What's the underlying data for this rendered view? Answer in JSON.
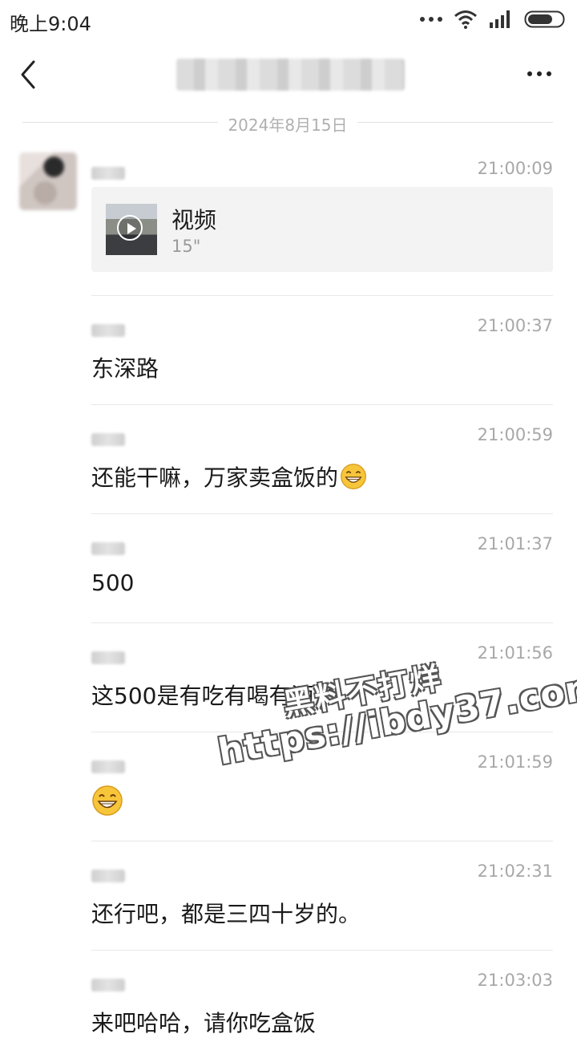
{
  "status_bar": {
    "time": "晚上9:04"
  },
  "nav": {
    "title": ""
  },
  "date_divider": "2024年8月15日",
  "messages": [
    {
      "time": "21:00:09",
      "type": "video",
      "video_label": "视频",
      "duration": "15\""
    },
    {
      "time": "21:00:37",
      "text": "东深路"
    },
    {
      "time": "21:00:59",
      "text": "还能干嘛，万家卖盒饭的",
      "emoji": "grinning-face-emoji"
    },
    {
      "time": "21:01:37",
      "text": "500"
    },
    {
      "time": "21:01:56",
      "text": "这500是有吃有喝有酒了"
    },
    {
      "time": "21:01:59",
      "emoji": "grinning-face-emoji"
    },
    {
      "time": "21:02:31",
      "text": "还行吧，都是三四十岁的。"
    },
    {
      "time": "21:03:03",
      "text": "来吧哈哈，请你吃盒饭"
    }
  ],
  "watermark": {
    "cn": "黑料不打烊",
    "url": "https://ibdy37.com"
  },
  "colors": {
    "timestamp": "#a8a8a8",
    "divider": "#e8e8e8",
    "video_card_bg": "#f3f3f3"
  }
}
